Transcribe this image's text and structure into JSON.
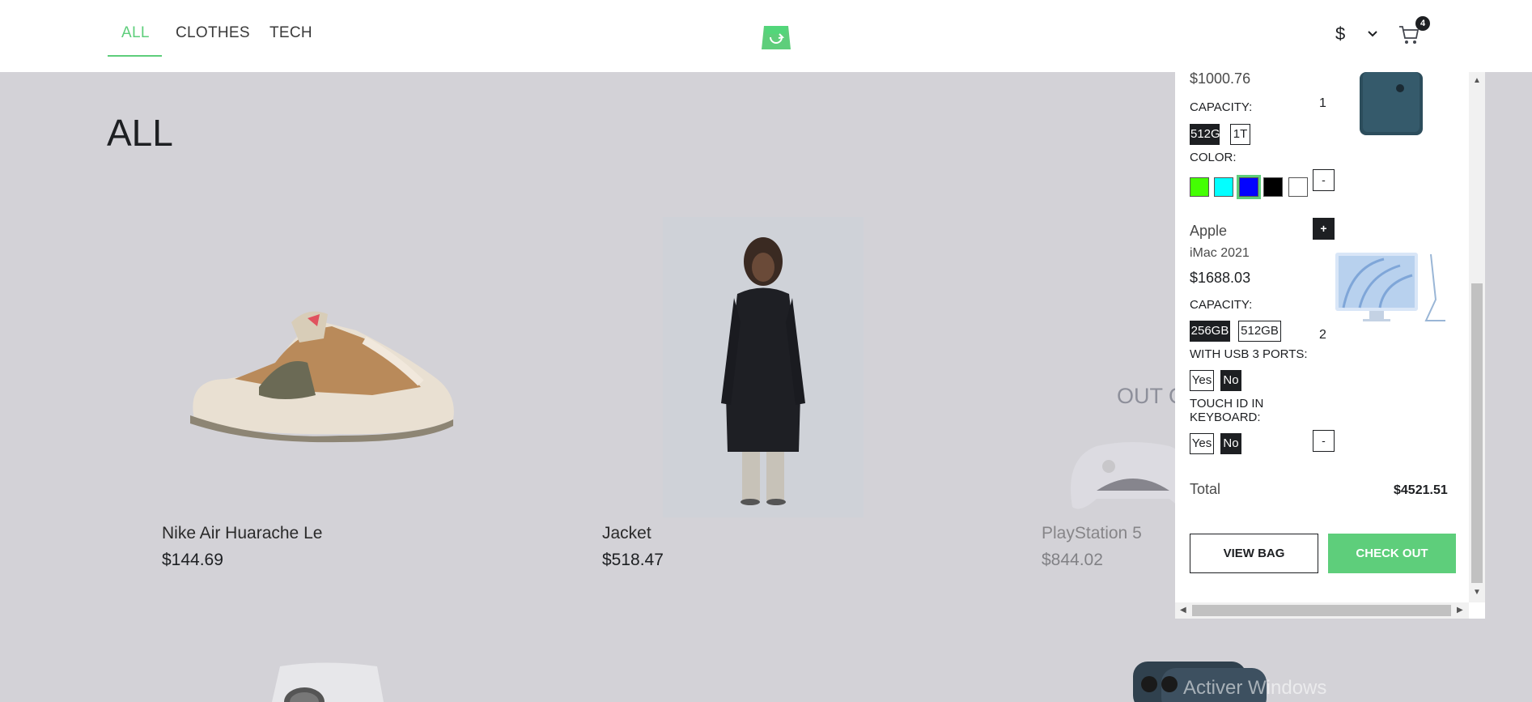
{
  "nav": {
    "tabs": [
      {
        "label": "ALL",
        "active": true
      },
      {
        "label": "CLOTHES",
        "active": false
      },
      {
        "label": "TECH",
        "active": false
      }
    ]
  },
  "header": {
    "logo_icon": "shopping-bag-icon",
    "currency_symbol": "$",
    "cart_count": "4"
  },
  "page": {
    "title": "ALL"
  },
  "products": [
    {
      "name": "Nike Air Huarache Le",
      "price": "$144.69"
    },
    {
      "name": "Jacket",
      "price": "$518.47"
    },
    {
      "name": "PlayStation 5",
      "price": "$844.02",
      "out_of_stock_label": "OUT O"
    }
  ],
  "cart": {
    "items": [
      {
        "price": "$1000.76",
        "quantity": "1",
        "attributes": [
          {
            "name": "CAPACITY:",
            "options": [
              "512G",
              "1T"
            ],
            "selected": "512G"
          },
          {
            "name": "COLOR:",
            "swatches": [
              "#44ff03",
              "#03ffff",
              "#0303ff",
              "#000000",
              "#ffffff"
            ],
            "selected_index": 2
          }
        ]
      },
      {
        "brand": "Apple",
        "name": "iMac 2021",
        "price": "$1688.03",
        "quantity": "2",
        "attributes": [
          {
            "name": "CAPACITY:",
            "options": [
              "256GB",
              "512GB"
            ],
            "selected": "256GB"
          },
          {
            "name": "WITH USB 3 PORTS:",
            "options": [
              "Yes",
              "No"
            ],
            "selected": "No"
          },
          {
            "name": "TOUCH ID IN",
            "name_line2": "KEYBOARD:",
            "options": [
              "Yes",
              "No"
            ],
            "selected": "No"
          }
        ]
      }
    ],
    "total_label": "Total",
    "total_value": "$4521.51",
    "view_bag_label": "VIEW BAG",
    "checkout_label": "CHECK OUT",
    "minus_label": "-",
    "plus_label": "+"
  },
  "watermark": "Activer Windows",
  "colors": {
    "accent": "#5ece7b",
    "dark": "#1d1f22",
    "backdrop": "#d3d2d7"
  }
}
